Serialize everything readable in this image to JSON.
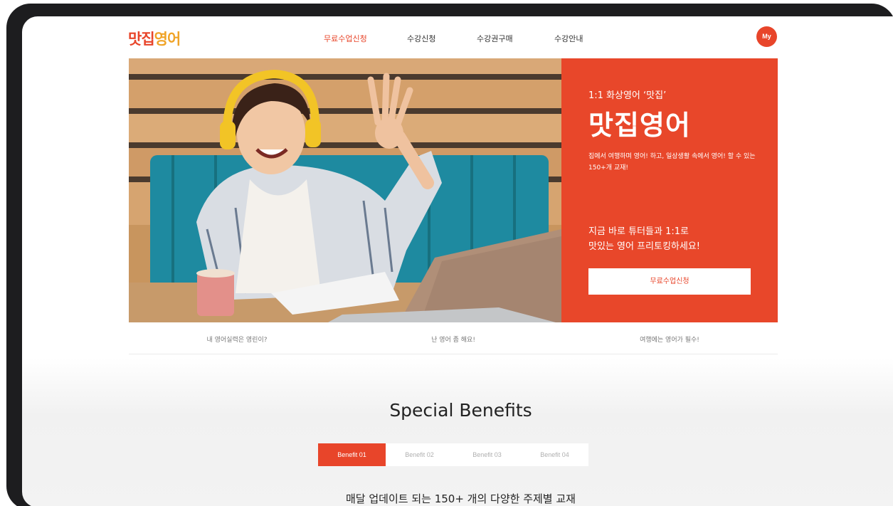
{
  "header": {
    "logo_text_1": "맛집",
    "logo_text_2": "영어",
    "nav": [
      "무료수업신청",
      "수강신청",
      "수강권구매",
      "수강안내"
    ],
    "my_label": "My"
  },
  "hero": {
    "subtitle": "1:1 화상영어 ‘맛집’",
    "title": "맛집영어",
    "description": "집에서 여행하며 영어! 하고, 일상생활 속에서 영어! 할 수 있는 150+개 교재!",
    "lead_line_1": "지금 바로 튜터들과 1:1로",
    "lead_line_2": "맛있는 영어 프리토킹하세요!",
    "cta_label": "무료수업신청"
  },
  "levels": [
    "내 영어실력은 영린이?",
    "난 영어 좀 해요!",
    "여행에는 영어가 필수!"
  ],
  "benefits": {
    "title": "Special Benefits",
    "tabs": [
      "Benefit 01",
      "Benefit 02",
      "Benefit 03",
      "Benefit 04"
    ],
    "active_tab": "Benefit 01",
    "caption": "매달 업데이트 되는 150+ 개의 다양한 주제별 교재"
  },
  "colors": {
    "accent": "#e8452a",
    "logo_secondary": "#f0a428",
    "seat": "#1e8aa0"
  }
}
